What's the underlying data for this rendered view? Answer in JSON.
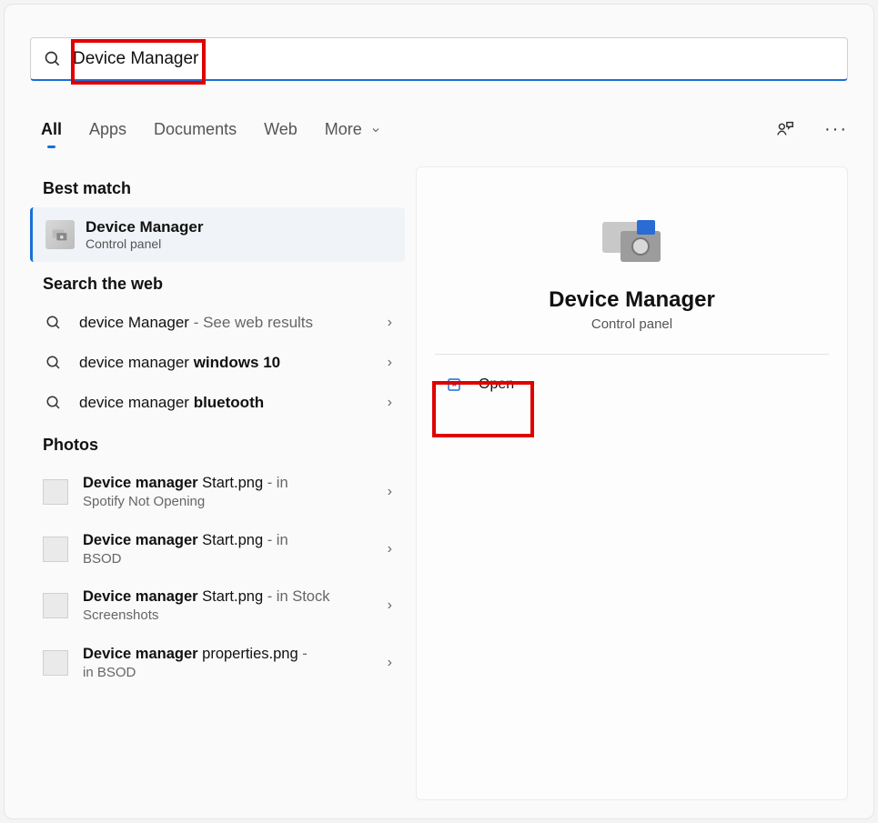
{
  "search": {
    "value": "Device Manager"
  },
  "tabs": {
    "all": "All",
    "apps": "Apps",
    "documents": "Documents",
    "web": "Web",
    "more": "More"
  },
  "sections": {
    "best_match": "Best match",
    "search_web": "Search the web",
    "photos": "Photos"
  },
  "best": {
    "title": "Device Manager",
    "subtitle": "Control panel"
  },
  "web_results": [
    {
      "pre": "device Manager",
      "post": "",
      "muted": " - See web results"
    },
    {
      "pre": "device manager ",
      "post": "windows 10",
      "muted": ""
    },
    {
      "pre": "device manager ",
      "post": "bluetooth",
      "muted": ""
    }
  ],
  "photo_results": [
    {
      "bold": "Device manager ",
      "rest": "Start.png",
      "muted": " - in",
      "line2": "Spotify Not Opening"
    },
    {
      "bold": "Device manager ",
      "rest": "Start.png",
      "muted": " - in",
      "line2": "BSOD"
    },
    {
      "bold": "Device manager ",
      "rest": "Start.png",
      "muted": " - in Stock",
      "line2": "Screenshots"
    },
    {
      "bold": "Device manager ",
      "rest": "properties.png",
      "muted": " -",
      "line2": "in BSOD"
    }
  ],
  "preview": {
    "title": "Device Manager",
    "subtitle": "Control panel",
    "open": "Open"
  }
}
